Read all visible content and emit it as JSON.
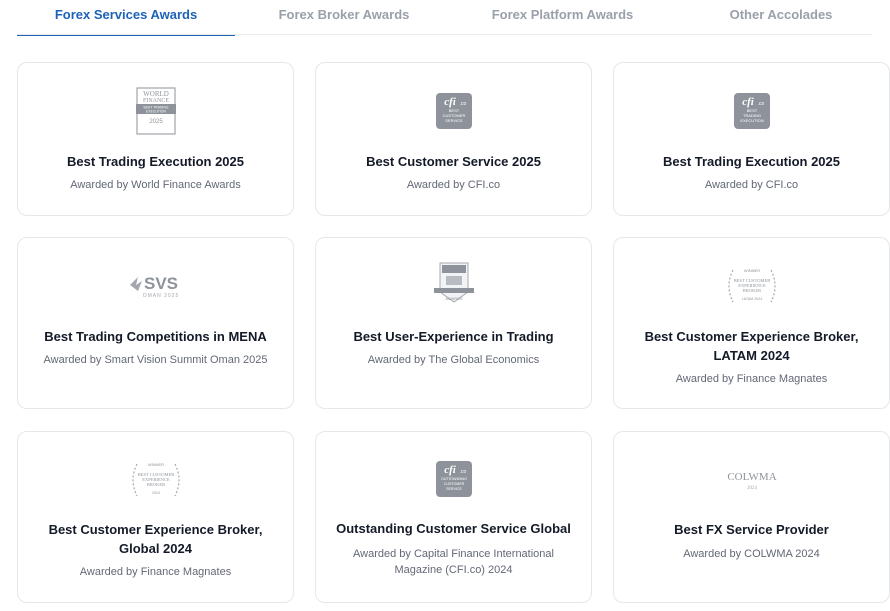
{
  "tabs": [
    {
      "label": "Forex Services Awards",
      "active": true
    },
    {
      "label": "Forex Broker Awards",
      "active": false
    },
    {
      "label": "Forex Platform Awards",
      "active": false
    },
    {
      "label": "Other Accolades",
      "active": false
    }
  ],
  "colors": {
    "accent": "#1d63b8",
    "logo_gray": "#8e939b"
  },
  "cards": [
    {
      "logo": "world-finance-badge",
      "logo_text": [
        "WORLD",
        "FINANCE",
        "BEST TRADING",
        "EXECUTION",
        "2025"
      ],
      "title": "Best Trading Execution 2025",
      "subtitle": "Awarded by World Finance Awards"
    },
    {
      "logo": "cfi-badge",
      "logo_text": [
        "cfi",
        ".co",
        "BEST",
        "CUSTOMER",
        "SERVICE"
      ],
      "title": "Best Customer Service 2025",
      "subtitle": "Awarded by CFI.co"
    },
    {
      "logo": "cfi-badge",
      "logo_text": [
        "cfi",
        ".co",
        "BEST",
        "TRADING",
        "EXECUTION"
      ],
      "title": "Best Trading Execution 2025",
      "subtitle": "Awarded by CFI.co"
    },
    {
      "logo": "svs-logo",
      "logo_text": [
        "SVS",
        "OMAN 2025"
      ],
      "title": "Best Trading Competitions in MENA",
      "subtitle": "Awarded by Smart Vision Summit Oman 2025"
    },
    {
      "logo": "global-economics-badge",
      "logo_text": [
        "AWARDS"
      ],
      "title": "Best User-Experience in Trading",
      "subtitle": "Awarded by The Global Economics"
    },
    {
      "logo": "laurel-badge",
      "logo_text": [
        "WINNER",
        "BEST CUSTOMER",
        "EXPERIENCE",
        "BROKER",
        "LATAM 2024"
      ],
      "title": "Best Customer Experience Broker, LATAM 2024",
      "subtitle": "Awarded by Finance Magnates"
    },
    {
      "logo": "laurel-badge",
      "logo_text": [
        "WINNER",
        "BEST CUSTOMER",
        "EXPERIENCE",
        "BROKER",
        "2024"
      ],
      "title": "Best Customer Experience Broker, Global 2024",
      "subtitle": "Awarded by Finance Magnates"
    },
    {
      "logo": "cfi-badge",
      "logo_text": [
        "cfi",
        ".co",
        "OUTSTANDING",
        "CUSTOMER",
        "SERVICE"
      ],
      "title": "Outstanding Customer Service Global",
      "subtitle": "Awarded by Capital Finance International Magazine (CFI.co) 2024"
    },
    {
      "logo": "colwma-logo",
      "logo_text": [
        "COLWMA",
        "2024"
      ],
      "title": "Best FX Service Provider",
      "subtitle": "Awarded by COLWMA 2024"
    }
  ]
}
